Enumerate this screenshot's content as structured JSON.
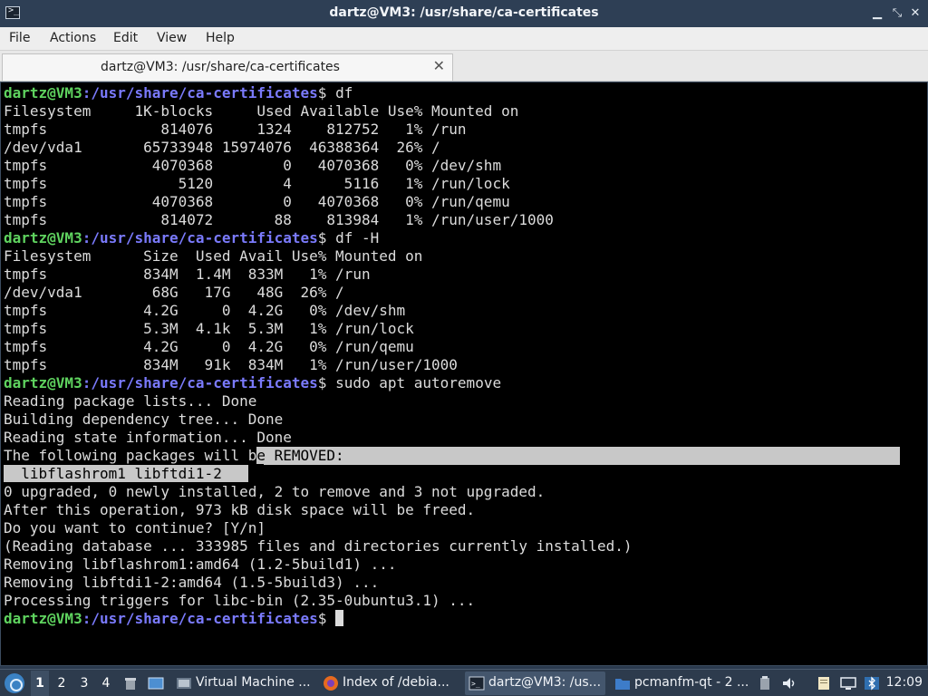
{
  "window": {
    "title": "dartz@VM3: /usr/share/ca-certificates",
    "controls": {
      "minimize": "▁",
      "maximize": "⤡",
      "close": "✕"
    }
  },
  "menu": [
    "File",
    "Actions",
    "Edit",
    "View",
    "Help"
  ],
  "tab": {
    "label": "dartz@VM3: /usr/share/ca-certificates",
    "close": "✕"
  },
  "terminal": {
    "prompt_user": "dartz@VM3",
    "prompt_path": ":/usr/share/ca-certificates",
    "prompt_sym": "$ ",
    "lines": [
      {
        "type": "prompt",
        "cmd": "df"
      },
      {
        "type": "out",
        "text": "Filesystem     1K-blocks     Used Available Use% Mounted on"
      },
      {
        "type": "out",
        "text": "tmpfs             814076     1324    812752   1% /run"
      },
      {
        "type": "out",
        "text": "/dev/vda1       65733948 15974076  46388364  26% /"
      },
      {
        "type": "out",
        "text": "tmpfs            4070368        0   4070368   0% /dev/shm"
      },
      {
        "type": "out",
        "text": "tmpfs               5120        4      5116   1% /run/lock"
      },
      {
        "type": "out",
        "text": "tmpfs            4070368        0   4070368   0% /run/qemu"
      },
      {
        "type": "out",
        "text": "tmpfs             814072       88    813984   1% /run/user/1000"
      },
      {
        "type": "prompt",
        "cmd": "df -H"
      },
      {
        "type": "out",
        "text": "Filesystem      Size  Used Avail Use% Mounted on"
      },
      {
        "type": "out",
        "text": "tmpfs           834M  1.4M  833M   1% /run"
      },
      {
        "type": "out",
        "text": "/dev/vda1        68G   17G   48G  26% /"
      },
      {
        "type": "out",
        "text": "tmpfs           4.2G     0  4.2G   0% /dev/shm"
      },
      {
        "type": "out",
        "text": "tmpfs           5.3M  4.1k  5.3M   1% /run/lock"
      },
      {
        "type": "out",
        "text": "tmpfs           4.2G     0  4.2G   0% /run/qemu"
      },
      {
        "type": "out",
        "text": "tmpfs           834M   91k  834M   1% /run/user/1000"
      },
      {
        "type": "prompt",
        "cmd": "sudo apt autoremove"
      },
      {
        "type": "out",
        "text": "Reading package lists... Done"
      },
      {
        "type": "out",
        "text": "Building dependency tree... Done"
      },
      {
        "type": "out",
        "text": "Reading state information... Done"
      },
      {
        "type": "sel1",
        "pre": "The following packages will b",
        "selected": "e REMOVED:"
      },
      {
        "type": "sel2",
        "selected": "  libflashrom1 libftdi1-2   "
      },
      {
        "type": "out",
        "text": "0 upgraded, 0 newly installed, 2 to remove and 3 not upgraded."
      },
      {
        "type": "out",
        "text": "After this operation, 973 kB disk space will be freed."
      },
      {
        "type": "out",
        "text": "Do you want to continue? [Y/n]"
      },
      {
        "type": "out",
        "text": "(Reading database ... 333985 files and directories currently installed.)"
      },
      {
        "type": "out",
        "text": "Removing libflashrom1:amd64 (1.2-5build1) ..."
      },
      {
        "type": "out",
        "text": "Removing libftdi1-2:amd64 (1.5-5build3) ..."
      },
      {
        "type": "out",
        "text": "Processing triggers for libc-bin (2.35-0ubuntu3.1) ..."
      },
      {
        "type": "prompt",
        "cmd": "",
        "cursor": true
      }
    ]
  },
  "taskbar": {
    "workspaces": [
      "1",
      "2",
      "3",
      "4"
    ],
    "tasks": [
      {
        "label": "Virtual Machine ...",
        "icon": "vm-icon"
      },
      {
        "label": "Index of /debia...",
        "icon": "firefox-icon"
      },
      {
        "label": "dartz@VM3: /us...",
        "icon": "terminal-icon"
      },
      {
        "label": "pcmanfm-qt - 2 ...",
        "icon": "folder-icon"
      }
    ],
    "clock": "12:09"
  },
  "colors": {
    "prompt_user": "#5fd35f",
    "prompt_path": "#7a7afc",
    "terminal_bg": "#000000",
    "selection": "#c8c8c8",
    "taskbar_bg": "#2d3b4d"
  }
}
